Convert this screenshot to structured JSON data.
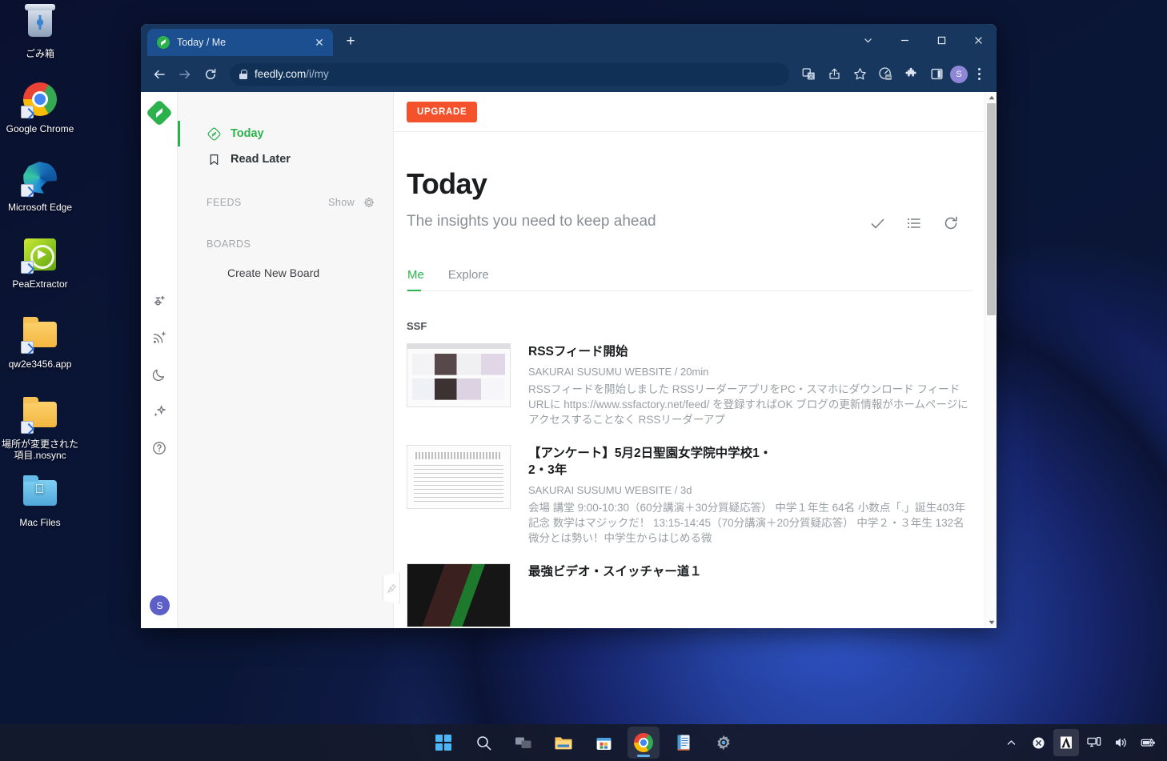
{
  "desktop": {
    "icons": [
      {
        "name": "recycle-bin",
        "label": "ごみ箱",
        "shortcut": false
      },
      {
        "name": "google-chrome",
        "label": "Google Chrome",
        "shortcut": true
      },
      {
        "name": "microsoft-edge",
        "label": "Microsoft Edge",
        "shortcut": true
      },
      {
        "name": "peaextractor",
        "label": "PeaExtractor",
        "shortcut": true
      },
      {
        "name": "folder-app",
        "label": "qw2e3456.app",
        "shortcut": true
      },
      {
        "name": "folder-nosync",
        "label": "場所が変更された項目.nosync",
        "shortcut": true
      },
      {
        "name": "mac-files",
        "label": "Mac Files",
        "shortcut": false
      }
    ]
  },
  "browser": {
    "tab": {
      "title": "Today / Me",
      "favicon": "feedly-icon",
      "close_label": "✕"
    },
    "new_tab_label": "+",
    "window_controls": {
      "more": "chevron-down-icon",
      "minimize": "minimize-icon",
      "maximize": "maximize-icon",
      "close": "close-icon"
    },
    "toolbar": {
      "back": "back-arrow-icon",
      "forward": "forward-arrow-icon",
      "reload": "reload-icon",
      "url_host": "feedly.com",
      "url_path": "/i/my",
      "translate": "translate-icon",
      "share": "share-icon",
      "bookmark": "star-icon",
      "speed": "speedometer-icon",
      "extensions": "puzzle-icon",
      "sidepanel": "side-panel-icon",
      "profile_initial": "S",
      "menu": "kebab-menu-icon"
    }
  },
  "app": {
    "rail": {
      "logo": "feedly-logo-icon",
      "buttons": [
        "add-people-icon",
        "add-feed-icon",
        "dark-mode-icon",
        "ai-sparkle-icon",
        "help-icon"
      ],
      "avatar_initial": "S"
    },
    "nav": {
      "items": [
        {
          "label": "Today",
          "icon": "feedly-today-icon",
          "active": true
        },
        {
          "label": "Read Later",
          "icon": "bookmark-icon",
          "active": false
        }
      ],
      "feeds_section": {
        "title": "FEEDS",
        "action": "Show",
        "settings_icon": "gear-icon"
      },
      "boards_section": {
        "title": "BOARDS",
        "create_label": "Create New Board"
      },
      "collapse_icon": "pin-icon"
    },
    "main": {
      "upgrade_label": "UPGRADE",
      "title": "Today",
      "subtitle": "The insights you need to keep ahead",
      "actions": [
        "mark-read-check-icon",
        "list-view-icon",
        "refresh-icon"
      ],
      "tabs": [
        {
          "label": "Me",
          "selected": true
        },
        {
          "label": "Explore",
          "selected": false
        }
      ],
      "group_label": "SSF",
      "entries": [
        {
          "thumb": "t1",
          "title": "RSSフィード開始",
          "meta": "SAKURAI SUSUMU WEBSITE / 20min",
          "snippet": "RSSフィードを開始しました RSSリーダーアプリをPC・スマホにダウンロード フィードURLに https://www.ssfactory.net/feed/ を登録すればOK ブログの更新情報がホームページにアクセスすることなく RSSリーダーアプ"
        },
        {
          "thumb": "t2",
          "title": "【アンケート】5月2日聖園女学院中学校1・2・3年",
          "meta": "SAKURAI SUSUMU WEBSITE / 3d",
          "snippet": "会場 講堂 9:00-10:30（60分講演＋30分質疑応答） 中学１年生 64名 小数点「.」誕生403年記念 数学はマジックだ！ 13:15-14:45（70分講演＋20分質疑応答） 中学２・３年生 132名 微分とは勢い！中学生からはじめる微"
        },
        {
          "thumb": "t3",
          "title": "最強ビデオ・スイッチャー道１",
          "meta": "",
          "snippet": ""
        }
      ],
      "scrollbar": {
        "up": "scroll-up-arrow-icon",
        "down": "scroll-down-arrow-icon"
      }
    }
  },
  "taskbar": {
    "items": [
      {
        "name": "start-button",
        "icon": "windows-logo-icon"
      },
      {
        "name": "search-button",
        "icon": "search-icon"
      },
      {
        "name": "task-view-button",
        "icon": "task-view-icon"
      },
      {
        "name": "file-explorer",
        "icon": "folder-icon"
      },
      {
        "name": "microsoft-store",
        "icon": "store-icon"
      },
      {
        "name": "google-chrome",
        "icon": "chrome-icon",
        "active": true
      },
      {
        "name": "notepad",
        "icon": "notepad-icon"
      },
      {
        "name": "settings",
        "icon": "gear-icon"
      }
    ],
    "tray": [
      {
        "name": "show-hidden-icons",
        "icon": "chevron-up-icon"
      },
      {
        "name": "close-tray-item",
        "icon": "circle-x-icon"
      },
      {
        "name": "app-tray-icon",
        "icon": "triangle-app-icon",
        "boxed": true
      },
      {
        "name": "network",
        "icon": "network-icon"
      },
      {
        "name": "volume",
        "icon": "speaker-icon"
      },
      {
        "name": "battery",
        "icon": "battery-icon"
      }
    ]
  }
}
